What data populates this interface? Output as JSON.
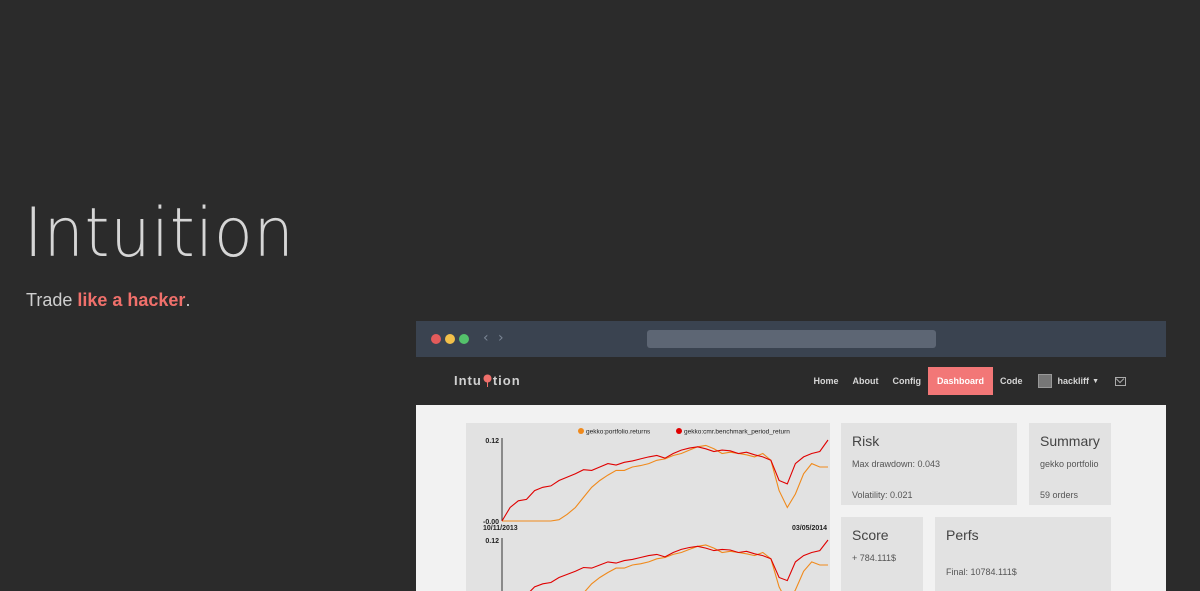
{
  "hero": {
    "title": "Intuition",
    "subtitle_prefix": "Trade ",
    "subtitle_accent": "like a hacker",
    "subtitle_suffix": "."
  },
  "browser": {
    "nav_back": "‹",
    "nav_forward": "›"
  },
  "app": {
    "brand_left": "Intu",
    "brand_right": "tion",
    "menu": [
      "Home",
      "About",
      "Config",
      "Dashboard",
      "Code"
    ],
    "active_menu": "Dashboard",
    "user": "hackliff"
  },
  "cards": {
    "risk": {
      "title": "Risk",
      "line1": "Max drawdown: 0.043",
      "line2": "Volatility: 0.021"
    },
    "summary": {
      "title": "Summary",
      "line1": "gekko portfolio",
      "line2": "59 orders"
    },
    "score": {
      "title": "Score",
      "line1": "+ 784.111$"
    },
    "perfs": {
      "title": "Perfs",
      "line1": "Final: 10784.111$"
    }
  },
  "colors": {
    "accent": "#f0706b",
    "series_portfolio": "#f08a1c",
    "series_benchmark": "#e00000"
  },
  "chart_data": [
    {
      "type": "line",
      "ylim": [
        0.0,
        0.12
      ],
      "y_tick_labels": [
        "0.12",
        "-0.00"
      ],
      "x_tick_labels": [
        "10/11/2013",
        "03/05/2014"
      ],
      "legend": [
        "gekko:portfolio.returns",
        "gekko:cmr.benchmark_period_return"
      ],
      "legend_position": "top",
      "x": [
        0,
        1,
        2,
        3,
        4,
        5,
        6,
        7,
        8,
        9,
        10,
        11,
        12,
        13,
        14,
        15,
        16,
        17,
        18,
        19,
        20,
        21,
        22,
        23,
        24,
        25,
        26,
        27,
        28,
        29,
        30,
        31,
        32,
        33,
        34,
        35,
        36,
        37,
        38,
        39,
        40
      ],
      "series": [
        {
          "name": "gekko:portfolio.returns",
          "values": [
            0.0,
            0.0,
            0.0,
            0.0,
            0.0,
            0.0,
            0.0,
            0.002,
            0.01,
            0.02,
            0.035,
            0.05,
            0.06,
            0.068,
            0.075,
            0.075,
            0.08,
            0.082,
            0.085,
            0.09,
            0.092,
            0.097,
            0.1,
            0.105,
            0.11,
            0.112,
            0.107,
            0.1,
            0.102,
            0.1,
            0.098,
            0.095,
            0.1,
            0.09,
            0.045,
            0.02,
            0.04,
            0.07,
            0.085,
            0.08,
            0.08
          ]
        },
        {
          "name": "gekko:cmr.benchmark_period_return",
          "values": [
            0.0,
            0.02,
            0.03,
            0.032,
            0.045,
            0.05,
            0.052,
            0.06,
            0.065,
            0.07,
            0.076,
            0.075,
            0.08,
            0.085,
            0.083,
            0.087,
            0.089,
            0.092,
            0.095,
            0.097,
            0.093,
            0.1,
            0.105,
            0.108,
            0.11,
            0.107,
            0.103,
            0.105,
            0.104,
            0.1,
            0.102,
            0.098,
            0.095,
            0.09,
            0.06,
            0.055,
            0.085,
            0.095,
            0.1,
            0.103,
            0.12
          ]
        }
      ]
    },
    {
      "type": "line",
      "ylim": [
        0.0,
        0.12
      ],
      "y_tick_labels": [
        "0.12"
      ],
      "x_tick_labels": [],
      "legend": [],
      "x": [
        0,
        1,
        2,
        3,
        4,
        5,
        6,
        7,
        8,
        9,
        10,
        11,
        12,
        13,
        14,
        15,
        16,
        17,
        18,
        19,
        20,
        21,
        22,
        23,
        24,
        25,
        26,
        27,
        28,
        29,
        30,
        31,
        32,
        33,
        34,
        35,
        36,
        37,
        38,
        39,
        40
      ],
      "series": [
        {
          "name": "gekko:portfolio.returns",
          "values": [
            0.0,
            0.0,
            0.0,
            0.0,
            0.0,
            0.0,
            0.0,
            0.002,
            0.01,
            0.02,
            0.035,
            0.05,
            0.06,
            0.068,
            0.075,
            0.075,
            0.08,
            0.082,
            0.085,
            0.09,
            0.092,
            0.097,
            0.1,
            0.105,
            0.11,
            0.112,
            0.107,
            0.1,
            0.102,
            0.1,
            0.098,
            0.095,
            0.1,
            0.09,
            0.045,
            0.02,
            0.04,
            0.07,
            0.085,
            0.08,
            0.08
          ]
        },
        {
          "name": "gekko:cmr.benchmark_period_return",
          "values": [
            0.0,
            0.02,
            0.03,
            0.032,
            0.045,
            0.05,
            0.052,
            0.06,
            0.065,
            0.07,
            0.076,
            0.075,
            0.08,
            0.085,
            0.083,
            0.087,
            0.089,
            0.092,
            0.095,
            0.097,
            0.093,
            0.1,
            0.105,
            0.108,
            0.11,
            0.107,
            0.103,
            0.105,
            0.104,
            0.1,
            0.102,
            0.098,
            0.095,
            0.09,
            0.06,
            0.055,
            0.085,
            0.095,
            0.1,
            0.103,
            0.12
          ]
        }
      ]
    }
  ]
}
